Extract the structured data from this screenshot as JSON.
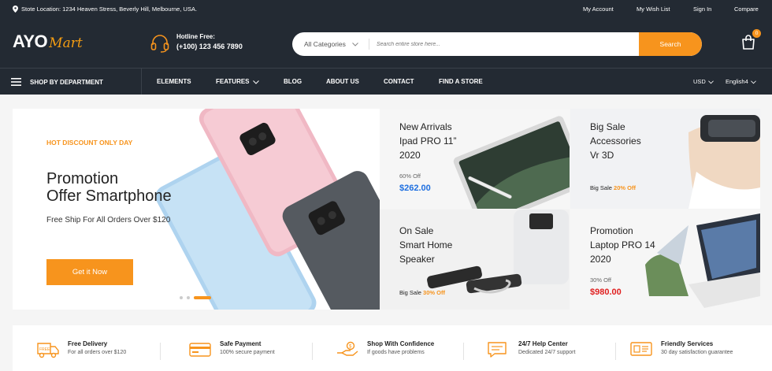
{
  "topbar": {
    "location": "Stote Location: 1234 Heaven Stress, Beverly Hill, Melbourne, USA.",
    "links": [
      "My Account",
      "My Wish List",
      "Sign In",
      "Compare"
    ]
  },
  "brand": {
    "logo_main": "AYO",
    "logo_script": "Mart"
  },
  "hotline": {
    "label": "Hotline Free:",
    "number": "(+100) 123 456 7890"
  },
  "search": {
    "category": "All Categories",
    "placeholder": "Search entire store here...",
    "button": "Search"
  },
  "cart": {
    "count": "0"
  },
  "nav": {
    "department": "SHOP BY DEPARTMENT",
    "items": [
      "ELEMENTS",
      "FEATURES",
      "BLOG",
      "ABOUT US",
      "CONTACT",
      "FIND A STORE"
    ],
    "currency": "USD",
    "language": "English4"
  },
  "hero": {
    "tag": "HOT DISCOUNT ONLY DAY",
    "title_line1": "Promotion",
    "title_line2": "Offer Smartphone",
    "subtitle": "Free Ship For All Orders Over $120",
    "cta": "Get it Now"
  },
  "cards": [
    {
      "line1": "New Arrivals",
      "line2": "Ipad PRO 11”",
      "line3": "2020",
      "off": "60% Off",
      "price": "$262.00",
      "price_color": "#1e6fe0"
    },
    {
      "line1": "Big Sale",
      "line2": "Accessories",
      "line3": "Vr 3D",
      "sale_label": "Big Sale",
      "sale_value": "20% Off"
    },
    {
      "line1": "On Sale",
      "line2": "Smart Home",
      "line3": "Speaker",
      "sale_label": "Big Sale",
      "sale_value": "30% Off"
    },
    {
      "line1": "Promotion",
      "line2": "Laptop PRO 14",
      "line3": "2020",
      "off": "30% Off",
      "price": "$980.00",
      "price_color": "#e02020"
    }
  ],
  "features": [
    {
      "icon": "delivery-truck-icon",
      "title": "Free Delivery",
      "sub": "For all orders over $120"
    },
    {
      "icon": "credit-card-icon",
      "title": "Safe Payment",
      "sub": "100% secure payment"
    },
    {
      "icon": "hand-money-icon",
      "title": "Shop With Confidence",
      "sub": "If goods have problems"
    },
    {
      "icon": "chat-bubble-icon",
      "title": "24/7 Help Center",
      "sub": "Dedicated 24/7 support"
    },
    {
      "icon": "monitor-icon",
      "title": "Friendly Services",
      "sub": "30 day satisfaction guarantee"
    }
  ],
  "colors": {
    "accent": "#f7941d",
    "dark": "#232a33"
  }
}
